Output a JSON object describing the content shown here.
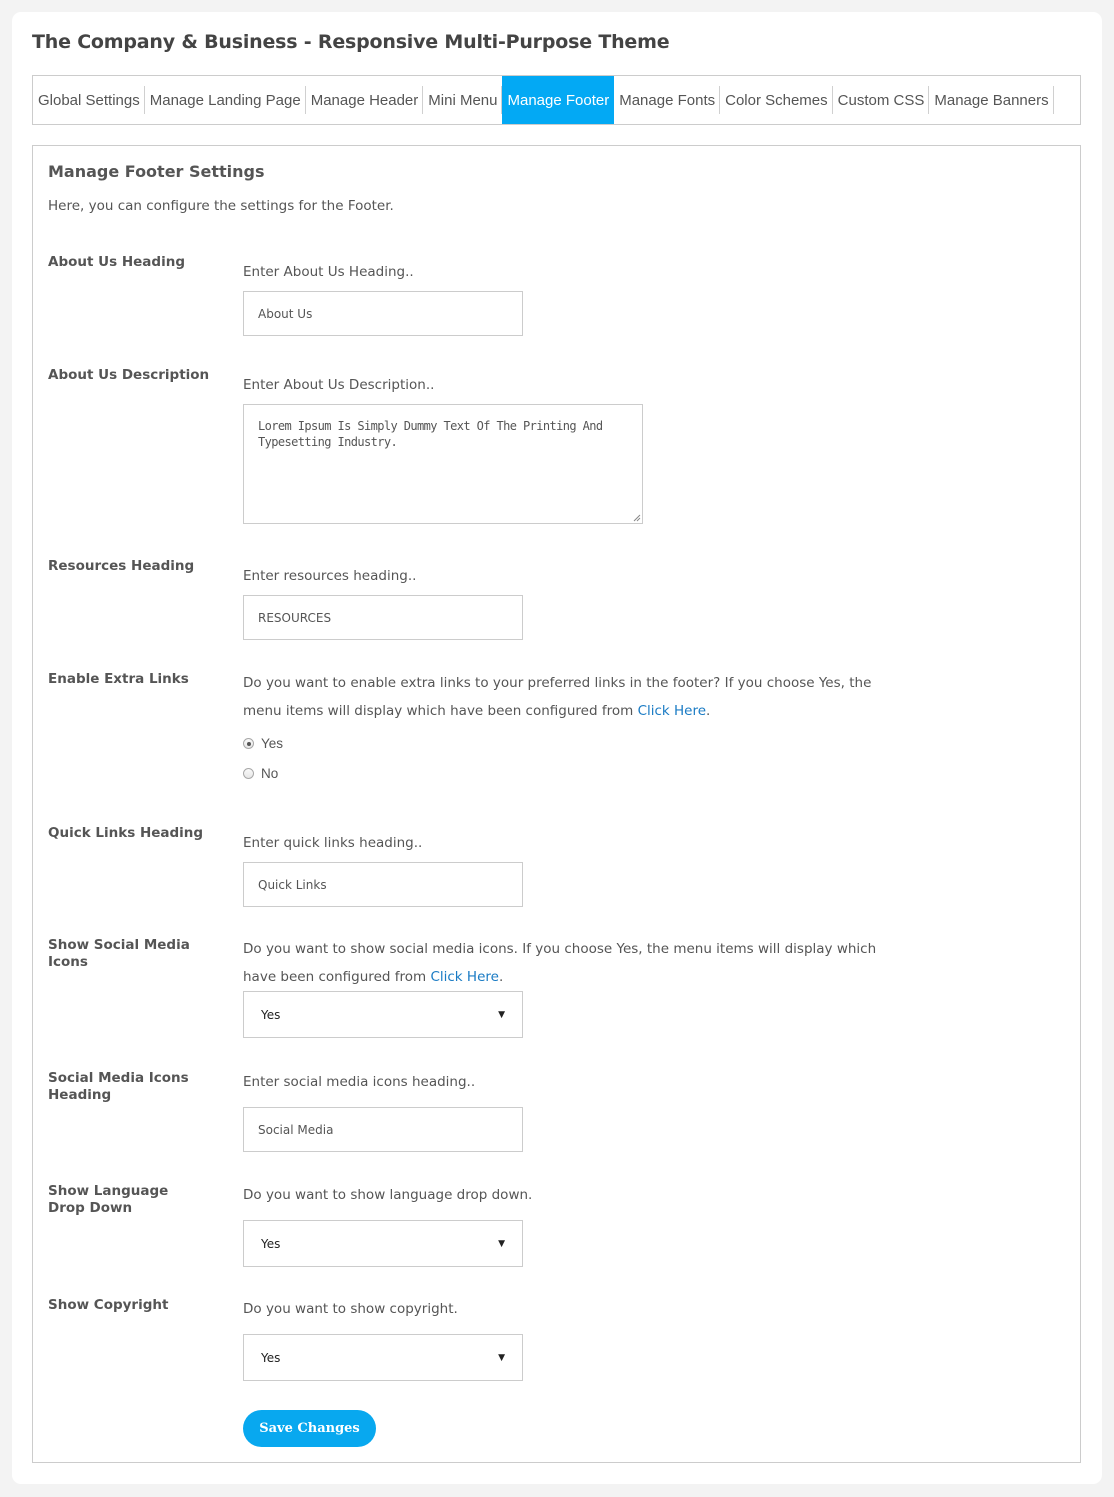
{
  "app": {
    "title": "The Company & Business - Responsive Multi-Purpose Theme"
  },
  "tabs": [
    {
      "label": "Global Settings",
      "active": false
    },
    {
      "label": "Manage Landing Page",
      "active": false
    },
    {
      "label": "Manage Header",
      "active": false
    },
    {
      "label": "Mini Menu",
      "active": false
    },
    {
      "label": "Manage Footer",
      "active": true
    },
    {
      "label": "Manage Fonts",
      "active": false
    },
    {
      "label": "Color Schemes",
      "active": false
    },
    {
      "label": "Custom CSS",
      "active": false
    },
    {
      "label": "Manage Banners",
      "active": false
    }
  ],
  "panel": {
    "title": "Manage Footer Settings",
    "description": "Here, you can configure the settings for the Footer."
  },
  "fields": {
    "about_heading": {
      "label": "About Us Heading",
      "hint": "Enter About Us Heading..",
      "value": "About Us"
    },
    "about_description": {
      "label": "About Us Description",
      "hint": "Enter About Us Description..",
      "value": "Lorem Ipsum Is Simply Dummy Text Of The Printing And Typesetting Industry."
    },
    "resources_heading": {
      "label": "Resources Heading",
      "hint": "Enter resources heading..",
      "value": "RESOURCES"
    },
    "extra_links": {
      "label": "Enable Extra Links",
      "hint_prefix": "Do you want to enable extra links to your preferred links in the footer? If you choose Yes, the menu items will display which have been configured from ",
      "link_text": "Click Here",
      "hint_suffix": ".",
      "options": [
        {
          "label": "Yes",
          "checked": true
        },
        {
          "label": "No",
          "checked": false
        }
      ]
    },
    "quick_links_heading": {
      "label": "Quick Links Heading",
      "hint": "Enter quick links heading..",
      "value": "Quick Links"
    },
    "social_icons": {
      "label": "Show Social Media Icons",
      "hint_prefix": "Do you want to show social media icons. If you choose Yes, the menu items will display which have been configured from ",
      "link_text": "Click Here",
      "hint_suffix": ".",
      "selected": "Yes"
    },
    "social_heading": {
      "label": "Social Media Icons Heading",
      "hint": "Enter social media icons heading..",
      "value": "Social Media"
    },
    "language_dropdown": {
      "label": "Show Language Drop Down",
      "hint": "Do you want to show language drop down.",
      "selected": "Yes"
    },
    "copyright": {
      "label": "Show Copyright",
      "hint": "Do you want to show copyright.",
      "selected": "Yes"
    }
  },
  "actions": {
    "save_label": "Save Changes"
  },
  "icons": {
    "select_caret": "▼"
  },
  "colors": {
    "accent": "#03a9f4",
    "link": "#1a7bc4",
    "button": "#08a8ef"
  }
}
